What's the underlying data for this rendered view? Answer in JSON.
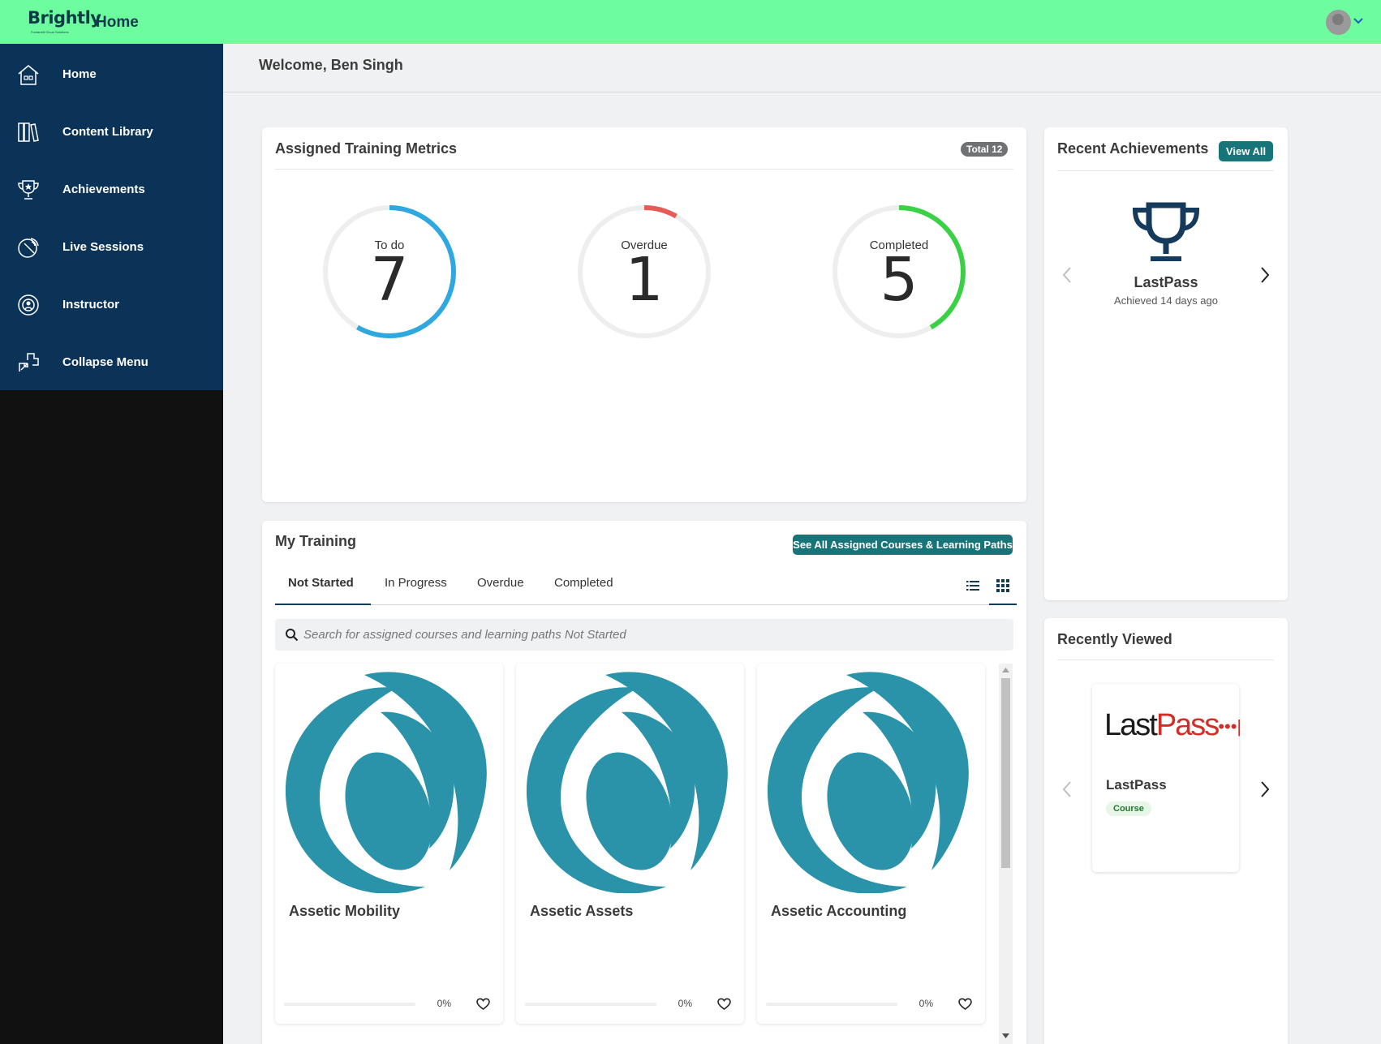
{
  "app": {
    "logo_text": "Brightly",
    "logo_subtext": "Fontanelli Cloud Solutions",
    "page_title": "Home"
  },
  "sidebar": {
    "items": [
      {
        "label": "Home",
        "icon": "home-icon"
      },
      {
        "label": "Content Library",
        "icon": "library-icon"
      },
      {
        "label": "Achievements",
        "icon": "trophy-icon"
      },
      {
        "label": "Live Sessions",
        "icon": "broadcast-icon"
      },
      {
        "label": "Instructor",
        "icon": "instructor-icon"
      },
      {
        "label": "Collapse Menu",
        "icon": "collapse-icon"
      }
    ]
  },
  "welcome": "Welcome, Ben Singh",
  "metrics": {
    "title": "Assigned Training Metrics",
    "total_label": "Total 12",
    "items": [
      {
        "label": "To do",
        "value": "7",
        "color": "#2fa8e0",
        "fraction": 0.583
      },
      {
        "label": "Overdue",
        "value": "1",
        "color": "#e45c55",
        "fraction": 0.083
      },
      {
        "label": "Completed",
        "value": "5",
        "color": "#3bd145",
        "fraction": 0.417
      }
    ]
  },
  "my_training": {
    "title": "My Training",
    "see_all_label": "See All Assigned Courses & Learning Paths",
    "tabs": [
      "Not Started",
      "In Progress",
      "Overdue",
      "Completed"
    ],
    "active_tab": "Not Started",
    "search_placeholder": "Search for assigned courses and learning paths Not Started",
    "courses": [
      {
        "title": "Assetic Mobility",
        "progress": "0%",
        "progress_fraction": 0
      },
      {
        "title": "Assetic Assets",
        "progress": "0%",
        "progress_fraction": 0
      },
      {
        "title": "Assetic Accounting",
        "progress": "0%",
        "progress_fraction": 0
      }
    ]
  },
  "recent_achievements": {
    "title": "Recent Achievements",
    "view_all_label": "View All",
    "item": {
      "name": "LastPass",
      "achieved": "Achieved 14 days ago"
    }
  },
  "recently_viewed": {
    "title": "Recently Viewed",
    "item": {
      "logo_text_dark": "Last",
      "logo_text_red": "Pass",
      "logo_dots": "•••|",
      "title": "LastPass",
      "badge": "Course"
    }
  },
  "colors": {
    "topbar": "#6dfd9e",
    "sidebar": "#0b3358",
    "accent": "#17757a",
    "course_thumb": "#2a93aa"
  }
}
